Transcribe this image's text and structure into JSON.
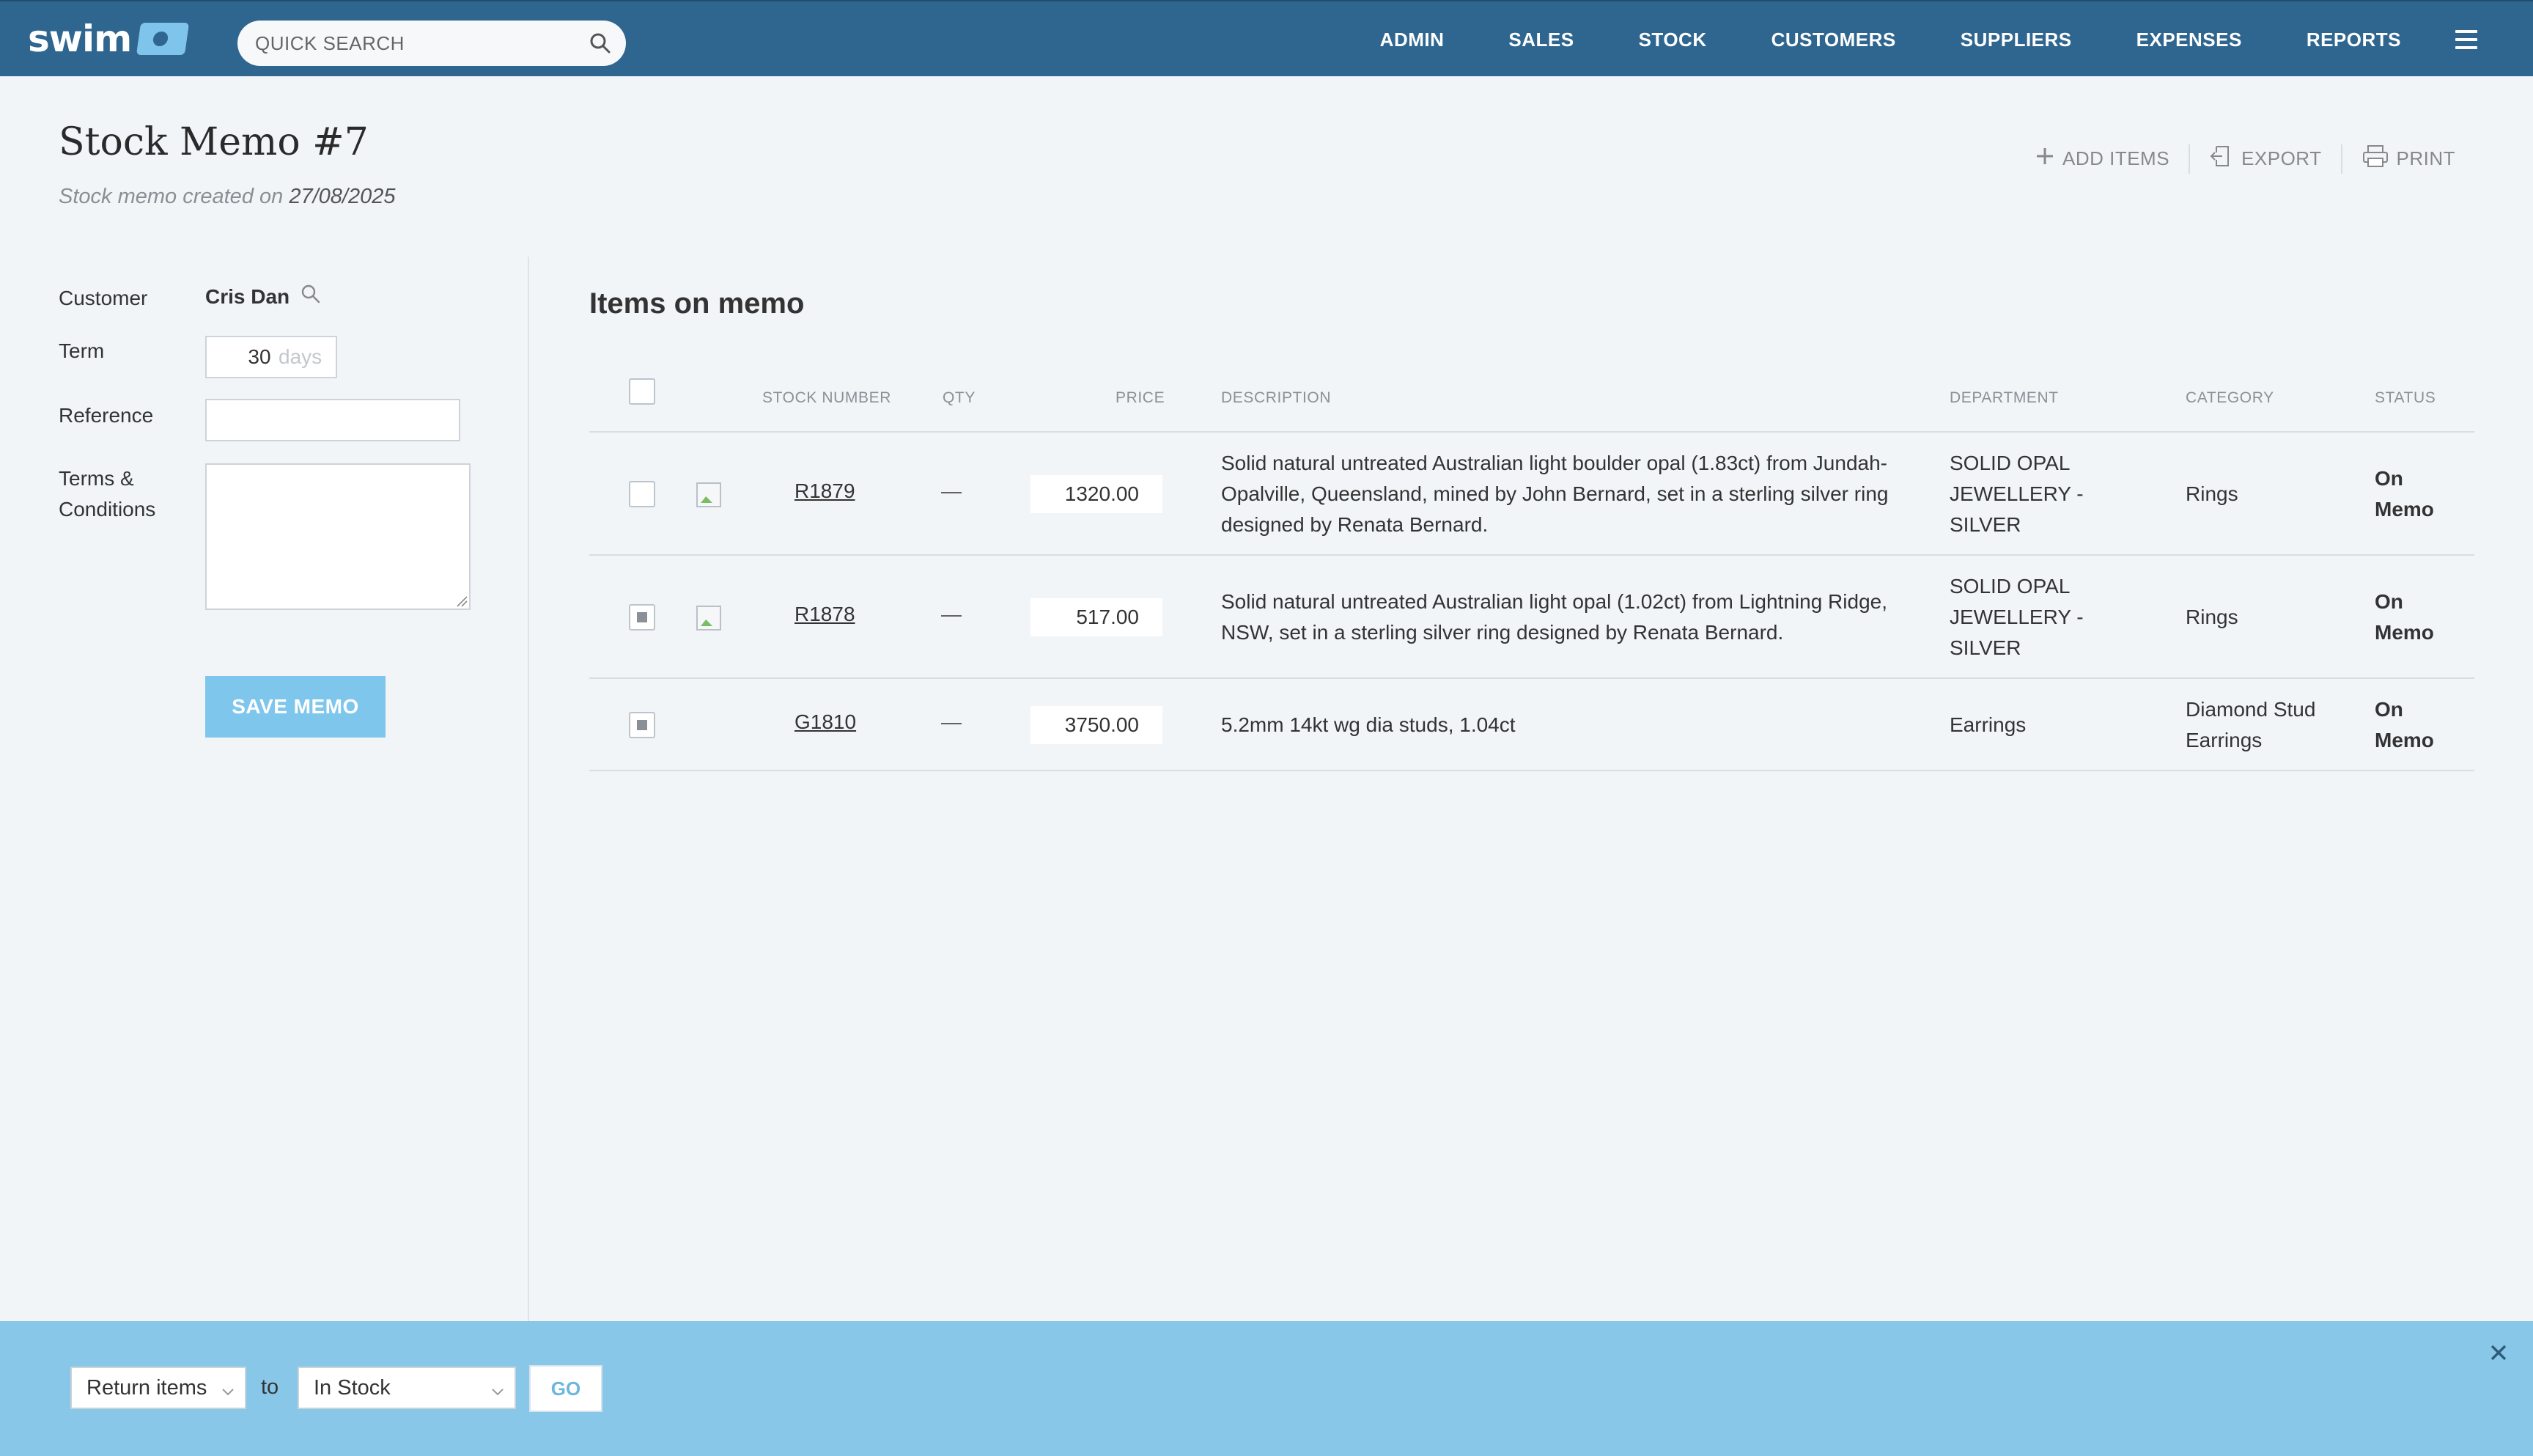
{
  "app": {
    "brand": "swim",
    "search_placeholder": "QUICK SEARCH",
    "nav": [
      "ADMIN",
      "SALES",
      "STOCK",
      "CUSTOMERS",
      "SUPPLIERS",
      "EXPENSES",
      "REPORTS"
    ]
  },
  "header": {
    "title": "Stock Memo #7",
    "subtitle_prefix": "Stock memo created on",
    "created_date": "27/08/2025",
    "actions": {
      "add_items": "ADD ITEMS",
      "export": "EXPORT",
      "print": "PRINT"
    }
  },
  "form": {
    "customer_label": "Customer",
    "customer_value": "Cris Dan",
    "term_label": "Term",
    "term_value": "30",
    "term_suffix": "days",
    "reference_label": "Reference",
    "reference_value": "",
    "terms_label": "Terms & Conditions",
    "terms_value": "",
    "save_label": "SAVE MEMO"
  },
  "items": {
    "title": "Items on memo",
    "columns": {
      "stock_number": "STOCK NUMBER",
      "qty": "QTY",
      "price": "PRICE",
      "description": "DESCRIPTION",
      "department": "DEPARTMENT",
      "category": "CATEGORY",
      "status": "STATUS"
    },
    "rows": [
      {
        "checked": false,
        "has_image": true,
        "stock_number": "R1879",
        "qty": "—",
        "price": "1320.00",
        "description": "Solid natural untreated Australian light boulder opal (1.83ct) from Jundah-Opalville, Queensland, mined by John Bernard, set in a sterling silver ring designed by Renata Bernard.",
        "department": "SOLID OPAL JEWELLERY - SILVER",
        "category": "Rings",
        "status": "On Memo"
      },
      {
        "checked": true,
        "has_image": true,
        "stock_number": "R1878",
        "qty": "—",
        "price": "517.00",
        "description": "Solid natural untreated Australian light opal (1.02ct) from Lightning Ridge, NSW, set in a sterling silver ring designed by Renata Bernard.",
        "department": "SOLID OPAL JEWELLERY - SILVER",
        "category": "Rings",
        "status": "On Memo"
      },
      {
        "checked": true,
        "has_image": false,
        "stock_number": "G1810",
        "qty": "—",
        "price": "3750.00",
        "description": "5.2mm 14kt wg dia studs, 1.04ct",
        "department": "Earrings",
        "category": "Diamond Stud Earrings",
        "status": "On Memo"
      }
    ]
  },
  "bulk_action": {
    "action_value": "Return items",
    "to_label": "to",
    "target_value": "In Stock",
    "go_label": "GO"
  },
  "colors": {
    "nav_bg": "#2f6690",
    "accent": "#7fc6ec",
    "bottom_bar": "#88c7e8",
    "page_bg": "#f1f5f8"
  }
}
